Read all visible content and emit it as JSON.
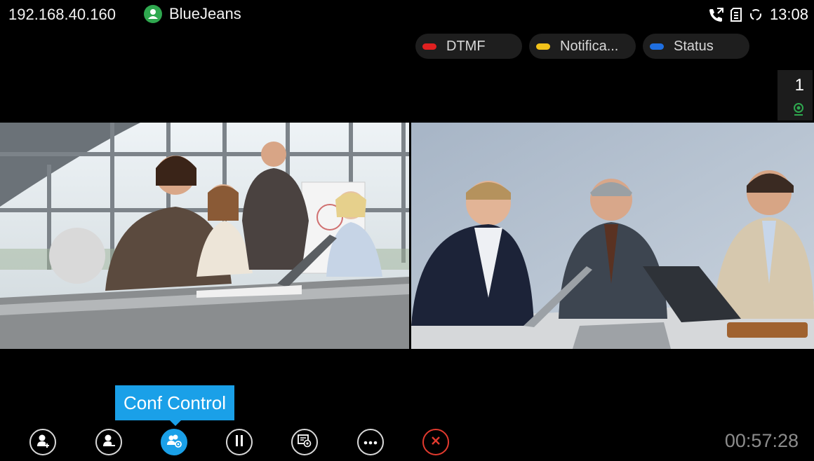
{
  "status_bar": {
    "ip": "192.168.40.160",
    "conference_name": "BlueJeans",
    "time": "13:08",
    "icons": [
      "call-forward-icon",
      "sd-card-icon",
      "sync-icon"
    ]
  },
  "tabs": [
    {
      "label": "DTMF",
      "color": "#e02020"
    },
    {
      "label": "Notifica...",
      "color": "#f2c21a"
    },
    {
      "label": "Status",
      "color": "#1f6fe0"
    }
  ],
  "layout_badge": {
    "number": "1",
    "icon": "camera-active-icon"
  },
  "videos": [
    {
      "name": "video-feed-left",
      "description_icon": "video-tile"
    },
    {
      "name": "video-feed-right",
      "description_icon": "video-tile"
    }
  ],
  "tooltip": {
    "label": "Conf Control"
  },
  "controls": [
    {
      "name": "add-participant-button",
      "icon": "add-person-icon"
    },
    {
      "name": "remove-participant-button",
      "icon": "remove-person-icon"
    },
    {
      "name": "conf-control-button",
      "icon": "conf-control-icon",
      "active": true
    },
    {
      "name": "hold-button",
      "icon": "pause-icon"
    },
    {
      "name": "record-button",
      "icon": "record-icon"
    },
    {
      "name": "more-button",
      "icon": "more-icon"
    },
    {
      "name": "end-call-button",
      "icon": "close-icon"
    }
  ],
  "call_timer": "00:57:28",
  "colors": {
    "accent": "#1aa0e8",
    "end_call": "#e23a2e",
    "conf_green": "#2fa84f"
  }
}
